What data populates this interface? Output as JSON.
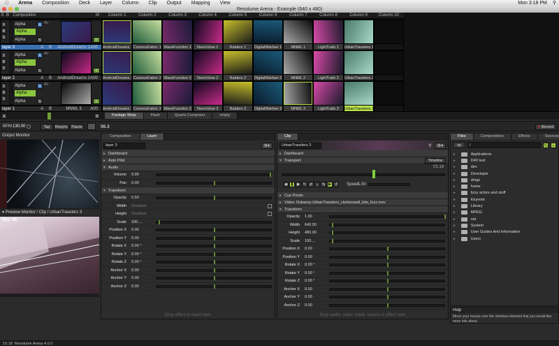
{
  "menubar": {
    "apple": "",
    "app": "Arena",
    "items": [
      "Composition",
      "Deck",
      "Layer",
      "Column",
      "Clip",
      "Output",
      "Mapping",
      "View"
    ],
    "clock": "Mon 3:18 PM",
    "search_icon": "search-icon"
  },
  "window": {
    "title": "Resolume Arena - Example (640 x 480)"
  },
  "composition": {
    "header_x": "X",
    "header_b": "B",
    "header_label": "Composition",
    "header_m": "M",
    "blend": "Alpha",
    "columns": [
      "Column 1",
      "Column 2",
      "Column 3",
      "Column 4",
      "Column 5",
      "Column 6",
      "Column 7",
      "Column 8",
      "Column 9",
      "Column 10"
    ]
  },
  "layers": [
    {
      "name": "layer 3",
      "blend": "Alpha",
      "preview": "AndroidDreams 1",
      "a": "A",
      "b": "B",
      "num": "A00",
      "clips": [
        "AndroidDreams 1",
        "CosmosFabric 1",
        "WaveFunction 1",
        "NeonGlow 1",
        "Raiders 1",
        "DigitalWarfare 1",
        "MNML 1",
        "LightTrails 1",
        "UrbanTravelers 1",
        ""
      ]
    },
    {
      "name": "layer 2",
      "blend": "Alpha",
      "preview": "AndroidDreams 2",
      "a": "A",
      "b": "B",
      "num": "A00",
      "clips": [
        "AndroidDreams 2",
        "CosmosFabric 2",
        "WaveFunction 2",
        "NeonGlow 2",
        "Raiders 2",
        "DigitalWarfare 2",
        "MNML 2",
        "LightTrails 2",
        "UrbanTravelers 2",
        ""
      ]
    },
    {
      "name": "layer 1",
      "blend": "Alpha",
      "preview": "MNML 3",
      "a": "A",
      "b": "B",
      "num": "A00",
      "clips": [
        "AndroidDreams 3",
        "CosmosFabric 3",
        "WaveFunction 3",
        "NeonGlow 3",
        "Raiders 3",
        "DigitalWarfare 3",
        "MNML 3",
        "LightTrails 3",
        "UrbanTravelers 3",
        ""
      ]
    }
  ],
  "decks": {
    "a": "A",
    "b": "B",
    "tabs": [
      "Footage Shop",
      "Flash",
      "Quartz Composer",
      "empty"
    ]
  },
  "transport": {
    "bpm_label": "BPM",
    "bpm": "130.00",
    "tap": "Tap",
    "resync": "Resync",
    "pause": "Pause",
    "master": "96.3",
    "record": "Record"
  },
  "output": {
    "title": "Output Monitor",
    "preview_title": "Preview Monitor / Clip / UrbanTravelers 3",
    "fps": "Fps: 30"
  },
  "layer_panel": {
    "tabs": [
      "Composition",
      "Layer"
    ],
    "name": "layer 3",
    "sections": {
      "dashboard": "Dashboard",
      "autopilot": "Auto Pilot",
      "audio": "Audio",
      "transform": "Transform"
    },
    "audio": [
      {
        "label": "Volume",
        "value": "0.99"
      },
      {
        "label": "Pan",
        "value": "0.00"
      }
    ],
    "transform": [
      {
        "label": "Opacity",
        "value": "0.50"
      },
      {
        "label": "Width",
        "value": "Disabled"
      },
      {
        "label": "Height",
        "value": "Disabled"
      },
      {
        "label": "Scale",
        "value": "100...."
      },
      {
        "label": "Position X",
        "value": "0.00"
      },
      {
        "label": "Position Y",
        "value": "0.00"
      },
      {
        "label": "Rotate X",
        "value": "0.00 °"
      },
      {
        "label": "Rotate Y",
        "value": "0.00 °"
      },
      {
        "label": "Rotate Z",
        "value": "0.00 °"
      },
      {
        "label": "Anchor X",
        "value": "0.00"
      },
      {
        "label": "Anchor Y",
        "value": "0.00"
      },
      {
        "label": "Anchor Z",
        "value": "0.00"
      }
    ],
    "drop_hint": "Drop effect or mask here"
  },
  "clip_panel": {
    "tab": "Clip",
    "name": "UrbanTravelers 3",
    "sections": {
      "dashboard": "Dashboard",
      "transport": "Transport",
      "cue": "Cue Points",
      "video": "Video: Dubassy-UrbanTravelers_clerkenwell_bits_fuzz.mov",
      "transform": "Transform"
    },
    "timeline": "Timeline",
    "time": "03.18",
    "speed_label": "Speed",
    "speed": "1.00",
    "transform": [
      {
        "label": "Opacity",
        "value": "1.00"
      },
      {
        "label": "Width",
        "value": "640.00"
      },
      {
        "label": "Height",
        "value": "480.00"
      },
      {
        "label": "Scale",
        "value": "100...."
      },
      {
        "label": "Position X",
        "value": "0.00"
      },
      {
        "label": "Position Y",
        "value": "0.00"
      },
      {
        "label": "Rotate X",
        "value": "0.00 °"
      },
      {
        "label": "Rotate Y",
        "value": "0.00 °"
      },
      {
        "label": "Rotate Z",
        "value": "0.00 °"
      },
      {
        "label": "Anchor X",
        "value": "0.00"
      },
      {
        "label": "Anchor Y",
        "value": "0.00"
      },
      {
        "label": "Anchor Z",
        "value": "0.00"
      }
    ],
    "drop_hint": "Drop audio, video, mask, source or effect here"
  },
  "browser": {
    "tabs": [
      "Files",
      "Compositions",
      "Effects",
      "Sources"
    ],
    "path": "/",
    "drive": "sp",
    "files": [
      "Applications",
      "D40 test",
      "dev",
      "Developer",
      "dmgs",
      "home",
      "lizzy actors and stuff",
      "Keynote",
      "Library",
      "MPEG",
      "net",
      "System",
      "User Guides And Information",
      "Users"
    ]
  },
  "help": {
    "title": "Help",
    "text": "Move your mouse over the interface element that you would like more info about."
  },
  "status": {
    "time": "15:18",
    "version": "Resolume Arena 4.0.0"
  },
  "colors": {
    "accent": "#b8e04a",
    "selected_blue": "#3a6fb0"
  }
}
